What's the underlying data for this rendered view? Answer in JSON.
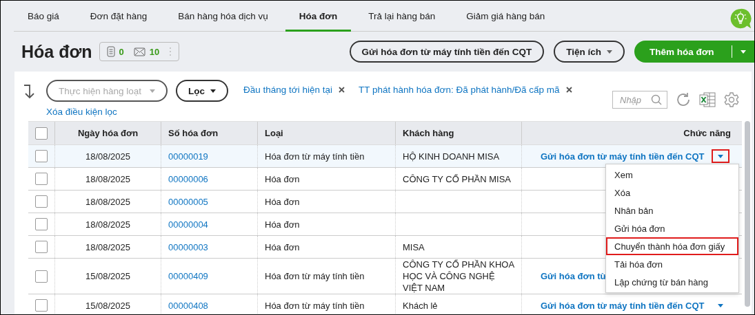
{
  "tabs": [
    {
      "label": "Báo giá",
      "selected": false
    },
    {
      "label": "Đơn đặt hàng",
      "selected": false
    },
    {
      "label": "Bán hàng hóa dịch vụ",
      "selected": false
    },
    {
      "label": "Hóa đơn",
      "selected": true
    },
    {
      "label": "Trả lại hàng bán",
      "selected": false
    },
    {
      "label": "Giảm giá hàng bán",
      "selected": false
    }
  ],
  "page_title": "Hóa đơn",
  "counters": [
    {
      "kind": "document",
      "count": "0"
    },
    {
      "kind": "mail",
      "count": "10"
    }
  ],
  "header_buttons": [
    {
      "label": "Gửi hóa đơn từ máy tính tiền đến CQT",
      "kind": "outline"
    },
    {
      "label": "Tiện ích",
      "kind": "dropdown"
    },
    {
      "label": "Thêm hóa đơn",
      "kind": "primary"
    }
  ],
  "filter": {
    "bulk_action": {
      "placeholder": "Thực hiện hàng loạt",
      "disabled": true
    },
    "filter_button": "Lọc",
    "chips": [
      "Đầu tháng tới hiện tại",
      "TT phát hành hóa đơn: Đã phát hành/Đã cấp mã"
    ],
    "clear_link": "Xóa điều kiện lọc",
    "search": {
      "placeholder": "Nhập"
    }
  },
  "table": {
    "select_all": {
      "checked": false
    },
    "columns": [
      "Ngày hóa đơn",
      "Số hóa đơn",
      "Loại",
      "Khách hàng",
      "Chức năng"
    ],
    "rows": [
      {
        "checked": false,
        "selected": true,
        "date": "18/08/2025",
        "number": "00000019",
        "type": "Hóa đơn từ máy tính tiền",
        "customer": "HỘ KINH DOANH MISA",
        "action": "Gửi hóa đơn từ máy tính tiền đến CQT",
        "caret_highlighted": true
      },
      {
        "checked": false,
        "selected": false,
        "date": "18/08/2025",
        "number": "00000006",
        "type": "Hóa đơn",
        "customer": "CÔNG TY CỔ PHẦN MISA"
      },
      {
        "checked": false,
        "selected": false,
        "date": "18/08/2025",
        "number": "00000005",
        "type": "Hóa đơn"
      },
      {
        "checked": false,
        "selected": false,
        "date": "18/08/2025",
        "number": "00000004",
        "type": "Hóa đơn"
      },
      {
        "checked": false,
        "selected": false,
        "date": "18/08/2025",
        "number": "00000003",
        "type": "Hóa đơn",
        "customer": "MISA"
      },
      {
        "checked": false,
        "selected": false,
        "date": "15/08/2025",
        "number": "00000409",
        "type": "Hóa đơn từ máy tính tiền",
        "customer": "CÔNG TY CỔ PHẦN KHOA HỌC VÀ CÔNG NGHỆ VIỆT NAM",
        "action": "Gửi hóa đơn từ"
      },
      {
        "checked": false,
        "selected": false,
        "date": "15/08/2025",
        "number": "00000408",
        "type": "Hóa đơn từ máy tính tiền",
        "customer": "Khách lẻ",
        "action": "Gửi hóa đơn từ máy tính tiền đến CQT",
        "caret_highlighted": false
      }
    ]
  },
  "action_menu": [
    {
      "label": "Xem",
      "highlighted": false
    },
    {
      "label": "Xóa",
      "highlighted": false
    },
    {
      "label": "Nhân bản",
      "highlighted": false
    },
    {
      "label": "Gửi hóa đơn",
      "highlighted": false
    },
    {
      "label": "Chuyển thành hóa đơn giấy",
      "highlighted": true
    },
    {
      "label": "Tải hóa đơn",
      "highlighted": false
    },
    {
      "label": "Lập chứng từ bán hàng",
      "highlighted": false
    }
  ]
}
